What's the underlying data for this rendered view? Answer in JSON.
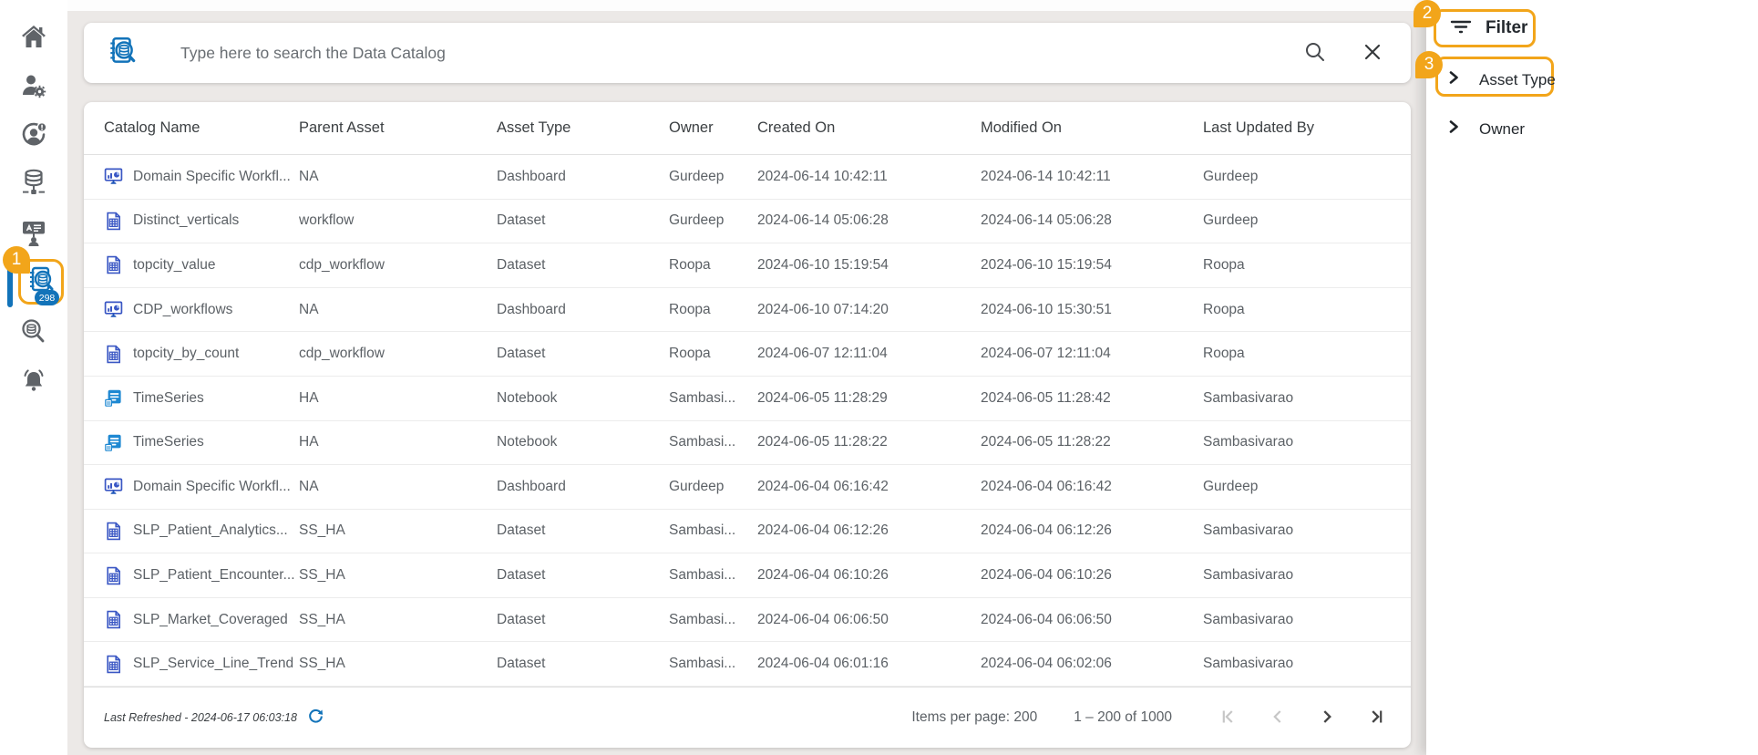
{
  "colors": {
    "accent_orange": "#f2a51a",
    "accent_blue": "#1273b9",
    "sidebar_icon_gray": "#5f6368",
    "dataset_icon_blue": "#3a57c4",
    "notebook_icon_blue": "#1e88d2",
    "text_primary": "#3c4043",
    "text_secondary": "#5c6166"
  },
  "annotations": {
    "step1": "1",
    "step2": "2",
    "step3": "3"
  },
  "sidebar": {
    "items": [
      {
        "id": "home",
        "icon": "home-icon"
      },
      {
        "id": "user-settings",
        "icon": "user-gear-icon"
      },
      {
        "id": "user-status",
        "icon": "user-shield-icon"
      },
      {
        "id": "data-sources",
        "icon": "database-network-icon"
      },
      {
        "id": "training",
        "icon": "presentation-user-icon"
      },
      {
        "id": "data-catalog",
        "icon": "data-catalog-icon",
        "active": true,
        "annotation": "1"
      },
      {
        "id": "asset-search",
        "icon": "search-database-icon"
      },
      {
        "id": "notifications",
        "icon": "bell-icon",
        "badge": "298"
      }
    ]
  },
  "search": {
    "placeholder": "Type here to search the Data Catalog"
  },
  "table": {
    "headers": [
      "Catalog Name",
      "Parent Asset",
      "Asset Type",
      "Owner",
      "Created On",
      "Modified On",
      "Last Updated By"
    ],
    "rows": [
      {
        "name": "Domain Specific Workfl...",
        "parent": "NA",
        "type": "Dashboard",
        "owner": "Gurdeep",
        "created": "2024-06-14 10:42:11",
        "modified": "2024-06-14 10:42:11",
        "updated_by": "Gurdeep"
      },
      {
        "name": "Distinct_verticals",
        "parent": "workflow",
        "type": "Dataset",
        "owner": "Gurdeep",
        "created": "2024-06-14 05:06:28",
        "modified": "2024-06-14 05:06:28",
        "updated_by": "Gurdeep"
      },
      {
        "name": "topcity_value",
        "parent": "cdp_workflow",
        "type": "Dataset",
        "owner": "Roopa",
        "created": "2024-06-10 15:19:54",
        "modified": "2024-06-10 15:19:54",
        "updated_by": "Roopa"
      },
      {
        "name": "CDP_workflows",
        "parent": "NA",
        "type": "Dashboard",
        "owner": "Roopa",
        "created": "2024-06-10 07:14:20",
        "modified": "2024-06-10 15:30:51",
        "updated_by": "Roopa"
      },
      {
        "name": "topcity_by_count",
        "parent": "cdp_workflow",
        "type": "Dataset",
        "owner": "Roopa",
        "created": "2024-06-07 12:11:04",
        "modified": "2024-06-07 12:11:04",
        "updated_by": "Roopa"
      },
      {
        "name": "TimeSeries",
        "parent": "HA",
        "type": "Notebook",
        "owner": "Sambasi...",
        "created": "2024-06-05 11:28:29",
        "modified": "2024-06-05 11:28:42",
        "updated_by": "Sambasivarao"
      },
      {
        "name": "TimeSeries",
        "parent": "HA",
        "type": "Notebook",
        "owner": "Sambasi...",
        "created": "2024-06-05 11:28:22",
        "modified": "2024-06-05 11:28:22",
        "updated_by": "Sambasivarao"
      },
      {
        "name": "Domain Specific Workfl...",
        "parent": "NA",
        "type": "Dashboard",
        "owner": "Gurdeep",
        "created": "2024-06-04 06:16:42",
        "modified": "2024-06-04 06:16:42",
        "updated_by": "Gurdeep"
      },
      {
        "name": "SLP_Patient_Analytics...",
        "parent": "SS_HA",
        "type": "Dataset",
        "owner": "Sambasi...",
        "created": "2024-06-04 06:12:26",
        "modified": "2024-06-04 06:12:26",
        "updated_by": "Sambasivarao"
      },
      {
        "name": "SLP_Patient_Encounter...",
        "parent": "SS_HA",
        "type": "Dataset",
        "owner": "Sambasi...",
        "created": "2024-06-04 06:10:26",
        "modified": "2024-06-04 06:10:26",
        "updated_by": "Sambasivarao"
      },
      {
        "name": "SLP_Market_Coveraged",
        "parent": "SS_HA",
        "type": "Dataset",
        "owner": "Sambasi...",
        "created": "2024-06-04 06:06:50",
        "modified": "2024-06-04 06:06:50",
        "updated_by": "Sambasivarao"
      },
      {
        "name": "SLP_Service_Line_Trend",
        "parent": "SS_HA",
        "type": "Dataset",
        "owner": "Sambasi...",
        "created": "2024-06-04 06:01:16",
        "modified": "2024-06-04 06:02:06",
        "updated_by": "Sambasivarao"
      }
    ]
  },
  "footer": {
    "last_refreshed": "Last Refreshed - 2024-06-17 06:03:18",
    "items_per_page_label": "Items per page: 200",
    "range_label": "1 – 200 of 1000"
  },
  "filter_panel": {
    "title": "Filter",
    "sections": [
      {
        "label": "Asset Type"
      },
      {
        "label": "Owner"
      }
    ]
  }
}
